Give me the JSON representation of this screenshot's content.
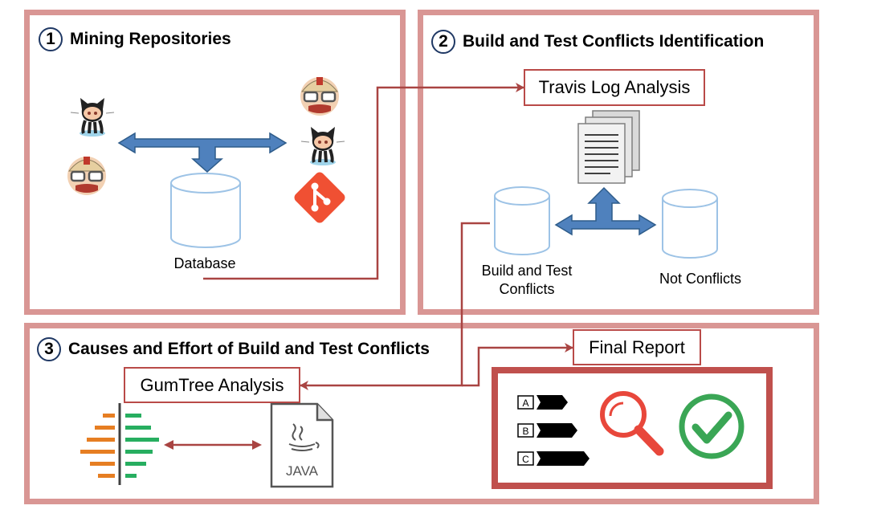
{
  "steps": [
    {
      "number": "1",
      "title": "Mining Repositories"
    },
    {
      "number": "2",
      "title": "Build and Test Conflicts Identification"
    },
    {
      "number": "3",
      "title": "Causes and Effort of Build and Test Conflicts"
    }
  ],
  "labels": {
    "database": "Database",
    "travis_log_analysis": "Travis Log Analysis",
    "build_test_conflicts_line1": "Build and Test",
    "build_test_conflicts_line2": "Conflicts",
    "not_conflicts": "Not Conflicts",
    "final_report": "Final Report",
    "gumtree_analysis": "GumTree Analysis",
    "java": "JAVA"
  },
  "report_items": [
    "A",
    "B",
    "C"
  ],
  "colors": {
    "panel_border": "#d99694",
    "connector": "#a94442",
    "blue_arrow": "#4f81bd",
    "db_stroke": "#9dc3e6",
    "git_orange": "#f05033",
    "check_green": "#3aa655",
    "magnifier_red": "#e8473b"
  },
  "icons": [
    "github-octocat-icon",
    "travis-ci-mascot-icon",
    "git-logo-icon",
    "database-icon",
    "document-stack-icon",
    "gumtree-diff-icon",
    "java-file-icon",
    "magnifier-icon",
    "checkmark-icon"
  ]
}
